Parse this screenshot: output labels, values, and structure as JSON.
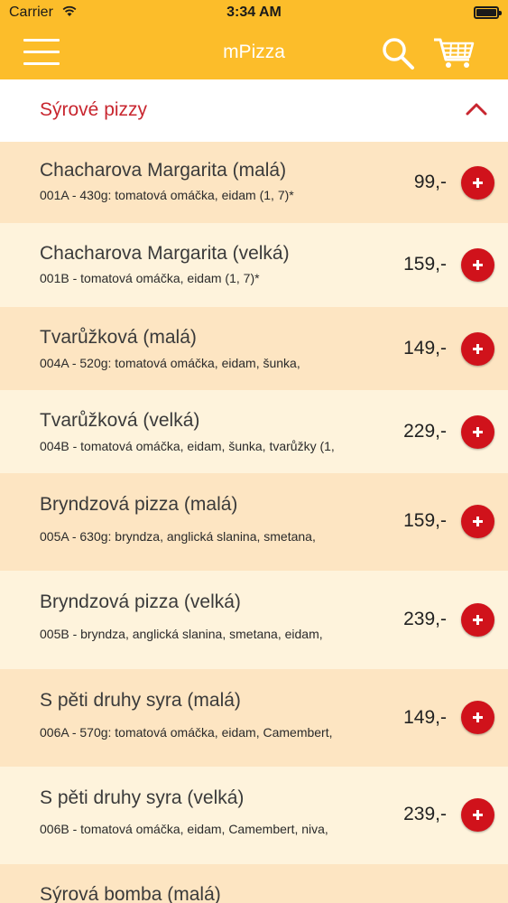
{
  "status_bar": {
    "carrier": "Carrier",
    "time": "3:34 AM"
  },
  "nav": {
    "title": "mPizza"
  },
  "section": {
    "title": "Sýrové pizzy"
  },
  "items": [
    {
      "name": "Chacharova Margarita (malá)",
      "desc": "001A - 430g: tomatová omáčka, eidam (1, 7)*",
      "price": "99,-"
    },
    {
      "name": "Chacharova Margarita (velká)",
      "desc": "001B - tomatová omáčka, eidam (1, 7)*",
      "price": "159,-"
    },
    {
      "name": "Tvarůžková (malá)",
      "desc": "004A - 520g: tomatová omáčka, eidam, šunka,",
      "price": "149,-"
    },
    {
      "name": "Tvarůžková (velká)",
      "desc": "004B - tomatová omáčka, eidam, šunka, tvarůžky (1,",
      "price": "229,-"
    },
    {
      "name": "Bryndzová pizza (malá)",
      "desc": "005A - 630g: bryndza, anglická slanina, smetana,",
      "price": "159,-"
    },
    {
      "name": "Bryndzová pizza (velká)",
      "desc": "005B - bryndza, anglická slanina, smetana, eidam,",
      "price": "239,-"
    },
    {
      "name": "S pěti druhy syra (malá)",
      "desc": "006A - 570g: tomatová omáčka, eidam, Camembert,",
      "price": "149,-"
    },
    {
      "name": "S pěti druhy syra (velká)",
      "desc": "006B - tomatová omáčka, eidam, Camembert, niva,",
      "price": "239,-"
    },
    {
      "name": "Sýrová bomba (malá)",
      "desc": "",
      "price": ""
    }
  ],
  "colors": {
    "header": "#fcbd2a",
    "accent": "#c8262f",
    "add_button": "#d0121b",
    "row_dark": "#fde5c2",
    "row_light": "#fef3dc"
  },
  "icons": {
    "menu": "hamburger-icon",
    "search": "search-icon",
    "cart": "cart-icon",
    "collapse": "chevron-up-icon",
    "add": "plus-icon"
  }
}
